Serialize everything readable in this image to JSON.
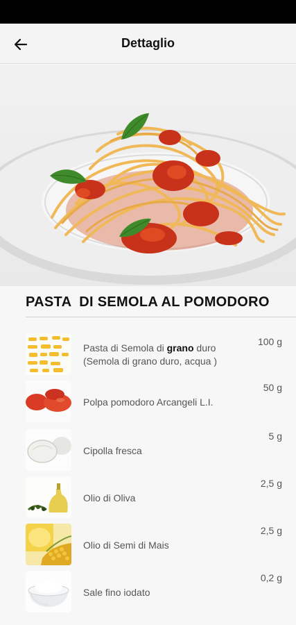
{
  "header": {
    "title": "Dettaglio"
  },
  "recipe": {
    "title": "PASTA  DI SEMOLA AL POMODORO"
  },
  "ingredients": [
    {
      "name_pre": "Pasta di Semola di ",
      "name_bold": "grano",
      "name_post": " duro",
      "name_line2": "(Semola di grano duro, acqua )",
      "qty": "100 g",
      "icon": "pasta-icon"
    },
    {
      "name": "Polpa pomodoro Arcangeli L.I.",
      "qty": "50 g",
      "icon": "tomato-icon"
    },
    {
      "name": "Cipolla fresca",
      "qty": "5 g",
      "icon": "onion-icon"
    },
    {
      "name": "Olio di Oliva",
      "qty": "2,5 g",
      "icon": "olive-oil-icon"
    },
    {
      "name": "Olio di Semi di Mais",
      "qty": "2,5 g",
      "icon": "corn-oil-icon"
    },
    {
      "name": "Sale fino iodato",
      "qty": "0,2 g",
      "icon": "salt-icon"
    }
  ]
}
